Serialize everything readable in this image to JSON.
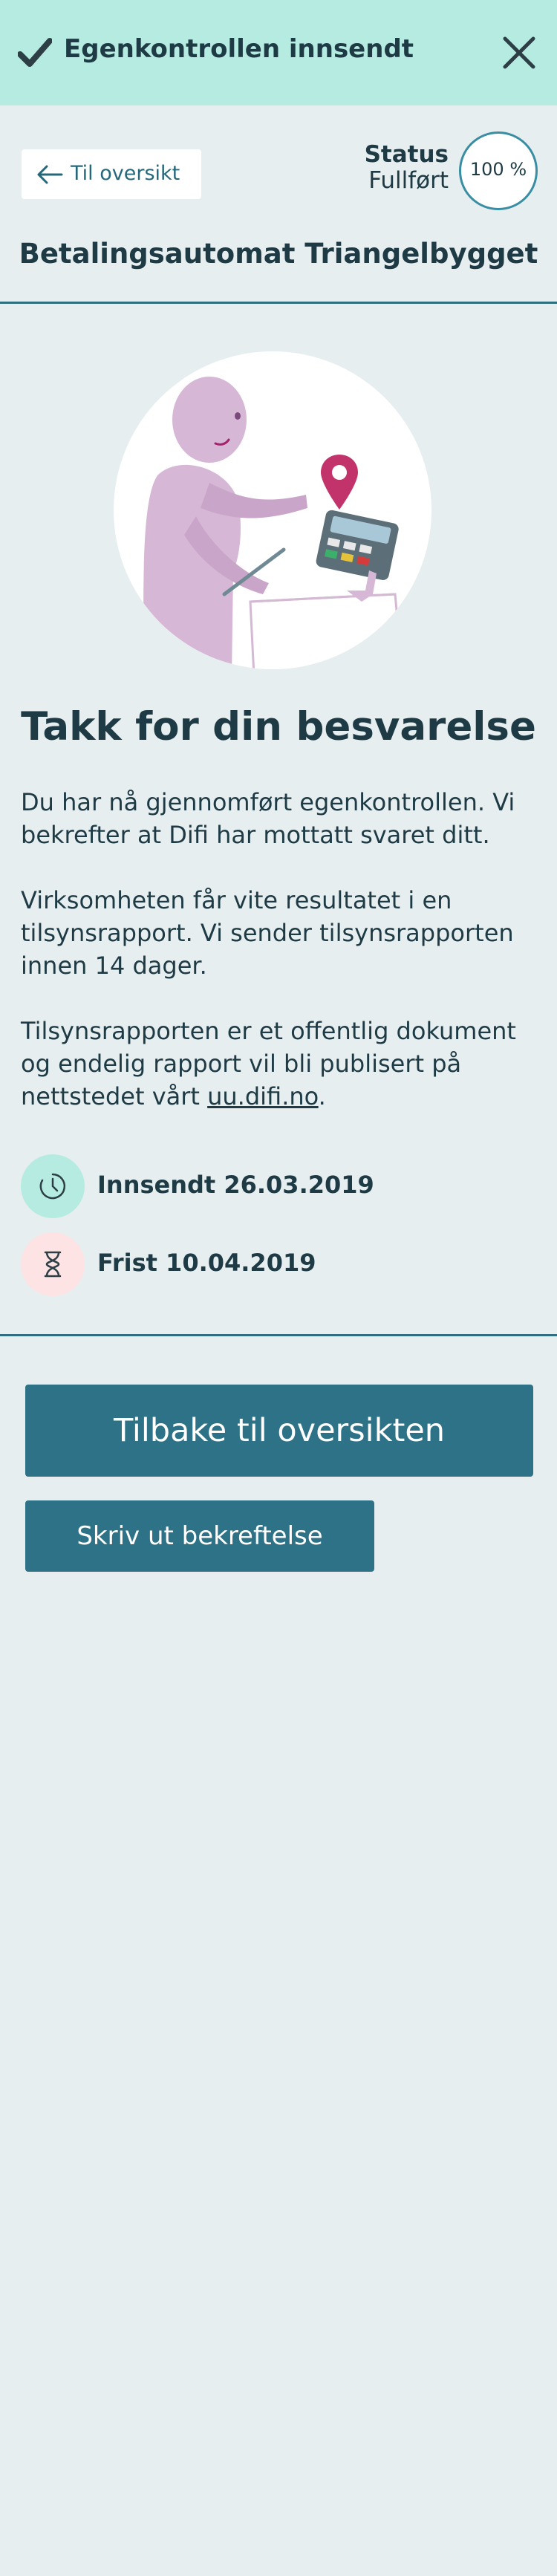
{
  "notification": {
    "title": "Egenkontrollen innsendt",
    "check_icon": "checkmark-icon",
    "close_icon": "close-icon",
    "background": "#b6ebe1"
  },
  "header": {
    "back_label": "Til oversikt",
    "status_title": "Status",
    "status_value": "Fullført",
    "progress_label": "100 %",
    "progress": 1.0,
    "object_name": "Betalingsautomat Triangelbygget"
  },
  "main": {
    "heading": "Takk for din besvarelse",
    "paragraph1": "Du har nå gjennomført egenkontrollen. Vi bekrefter at Difi har mottatt svaret ditt.",
    "paragraph2": "Virksomheten får vite resultatet i en tilsynsrapport. Vi sender tilsynsrapporten innen 14 dager.",
    "paragraph3_prefix": "Tilsynsrapporten er et offentlig dokument og endelig rapport vil bli publisert på nettstedet vårt ",
    "paragraph3_link": "uu.difi.no",
    "paragraph3_suffix": ".",
    "submitted": "Innsendt 26.03.2019",
    "submitted_icon": "clock-icon",
    "deadline": "Frist 10.04.2019",
    "deadline_icon": "hourglass-icon"
  },
  "actions": {
    "primary_label": "Tilbake til oversikten",
    "secondary_label": "Skriv ut bekreftelse"
  },
  "colors": {
    "page_bg": "#e7eef0",
    "button": "#2d7286",
    "text": "#1e3b45",
    "submitted_badge": "#b6ebe1",
    "deadline_badge": "#fde3e3"
  }
}
